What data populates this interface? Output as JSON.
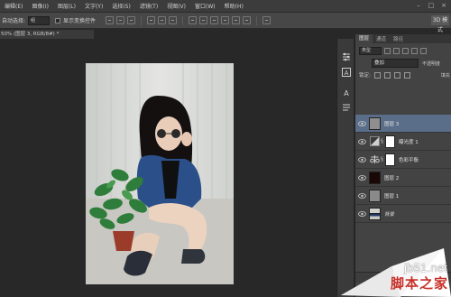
{
  "menu": {
    "items": [
      "编辑(E)",
      "图像(I)",
      "图层(L)",
      "文字(Y)",
      "选择(S)",
      "滤镜(T)",
      "视图(V)",
      "窗口(W)",
      "帮助(H)"
    ]
  },
  "options_bar": {
    "auto_select_label": "自动选择:",
    "auto_select_value": "组",
    "show_transform_label": "显示变换控件",
    "mode_3d": "3D 模式"
  },
  "document_tab": {
    "title": "50% (图层 3, RGB/8#) *"
  },
  "layers_panel": {
    "tabs": [
      "图层",
      "通道",
      "路径"
    ],
    "kind_filter": "类型",
    "blend_mode": "叠加",
    "opacity_label": "不透明度",
    "lock_label": "锁定:",
    "fill_label": "填充",
    "layers": [
      {
        "name": "图层 3",
        "selected": true,
        "thumb_color": "#8f8f8f",
        "type": "pixel"
      },
      {
        "name": "曝光度 1",
        "selected": false,
        "type": "adjustment",
        "icon": "exposure-icon"
      },
      {
        "name": "色彩平衡",
        "selected": false,
        "type": "adjustment",
        "icon": "color-balance-icon"
      },
      {
        "name": "图层 2",
        "selected": false,
        "thumb_color": "#1a0806",
        "type": "pixel"
      },
      {
        "name": "图层 1",
        "selected": false,
        "thumb_color": "#8a8a8a",
        "type": "pixel"
      },
      {
        "name": "背景",
        "selected": false,
        "thumb_color": "#5b5550",
        "type": "background"
      }
    ]
  },
  "watermark": {
    "url": "jb51.net",
    "brand": "脚本之家"
  }
}
